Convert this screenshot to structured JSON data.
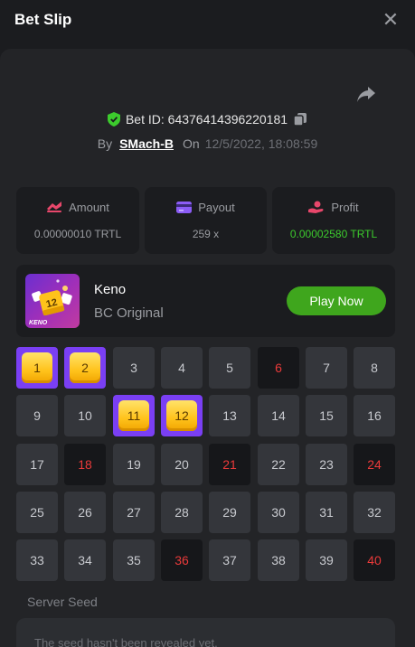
{
  "header": {
    "title": "Bet Slip",
    "close_icon": "close-icon"
  },
  "bet": {
    "id_label": "Bet ID:",
    "id_value": "64376414396220181",
    "by_label": "By",
    "user": "SMach-B",
    "on_label": "On",
    "date": "12/5/2022, 18:08:59"
  },
  "stats": {
    "amount": {
      "label": "Amount",
      "value": "0.00000010 TRTL",
      "icon": "amount-icon"
    },
    "payout": {
      "label": "Payout",
      "value": "259 x",
      "icon": "card-icon"
    },
    "profit": {
      "label": "Profit",
      "value": "0.00002580 TRTL",
      "icon": "profit-icon"
    }
  },
  "game": {
    "name": "Keno",
    "subtitle": "BC Original",
    "play_label": "Play Now",
    "thumb_number": "12",
    "thumb_text": "KENO"
  },
  "grid": {
    "numbers": [
      1,
      2,
      3,
      4,
      5,
      6,
      7,
      8,
      9,
      10,
      11,
      12,
      13,
      14,
      15,
      16,
      17,
      18,
      19,
      20,
      21,
      22,
      23,
      24,
      25,
      26,
      27,
      28,
      29,
      30,
      31,
      32,
      33,
      34,
      35,
      36,
      37,
      38,
      39,
      40
    ],
    "picked": [
      1,
      2,
      11,
      12
    ],
    "drawn": [
      6,
      18,
      21,
      24,
      36,
      40
    ]
  },
  "seed": {
    "label": "Server Seed",
    "value": "The seed hasn't been revealed yet."
  },
  "colors": {
    "accent_green": "#3fa61d",
    "profit_green": "#3ccb2d",
    "hit_red": "#ea3a3a",
    "pick_purple": "#7a3ff4",
    "gem_gold": "#ffc21b"
  }
}
